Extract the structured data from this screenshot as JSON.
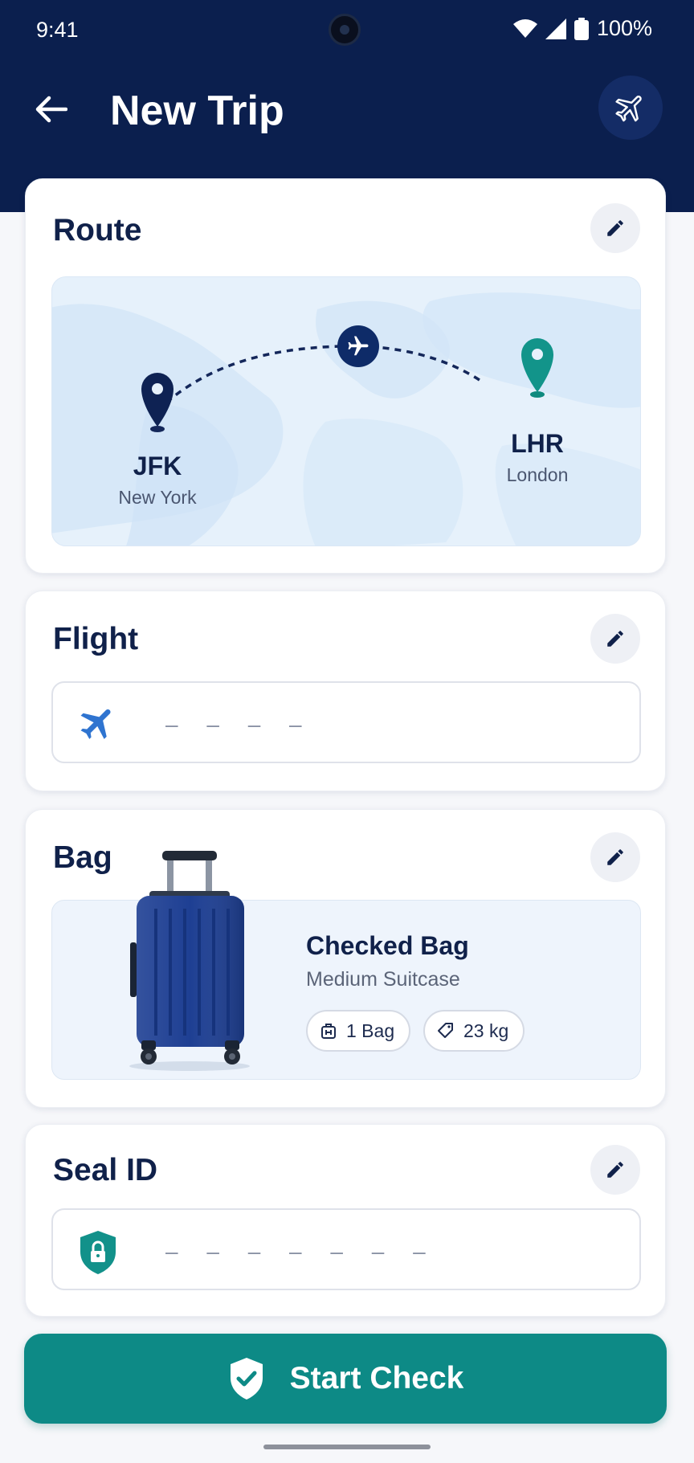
{
  "status_bar": {
    "time": "9:41",
    "battery": "100%"
  },
  "topbar": {
    "title": "New Trip",
    "back_icon": "arrow-left-icon",
    "action_icon": "airplane-icon"
  },
  "route": {
    "title": "Route",
    "origin": {
      "code": "JFK",
      "city": "New York"
    },
    "destination": {
      "code": "LHR",
      "city": "London"
    }
  },
  "flight": {
    "title": "Flight",
    "placeholder": "– – – –"
  },
  "bag": {
    "title": "Bag",
    "name": "Checked Bag",
    "subtitle": "Medium Suitcase",
    "count": "1 Bag",
    "weight": "23 kg"
  },
  "seal": {
    "title": "Seal ID",
    "placeholder": "– – – – – – –"
  },
  "cta": {
    "label": "Start Check"
  },
  "colors": {
    "header": "#0b1f4e",
    "accent": "#0d8a86",
    "flight_icon": "#2f74d0"
  }
}
